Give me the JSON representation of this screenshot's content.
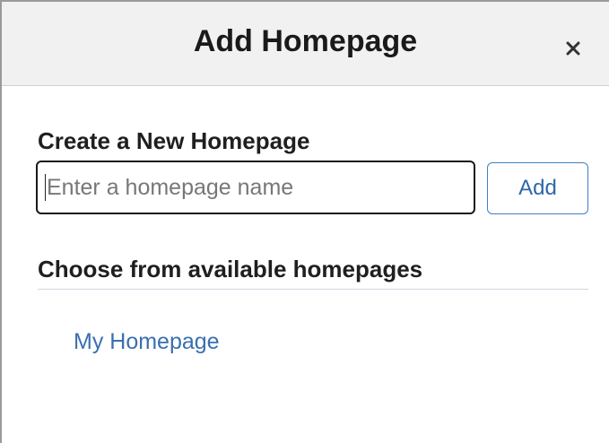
{
  "dialog": {
    "title": "Add Homepage",
    "close_icon": "close-icon"
  },
  "create": {
    "label": "Create a New Homepage",
    "input_value": "",
    "input_placeholder": "Enter a homepage name",
    "add_label": "Add"
  },
  "choose": {
    "label": "Choose from available homepages",
    "homepages": [
      {
        "label": "My Homepage"
      }
    ]
  },
  "colors": {
    "header_bg": "#f1f1f1",
    "link": "#3a6fb0",
    "button_border": "#3f7fc4"
  }
}
